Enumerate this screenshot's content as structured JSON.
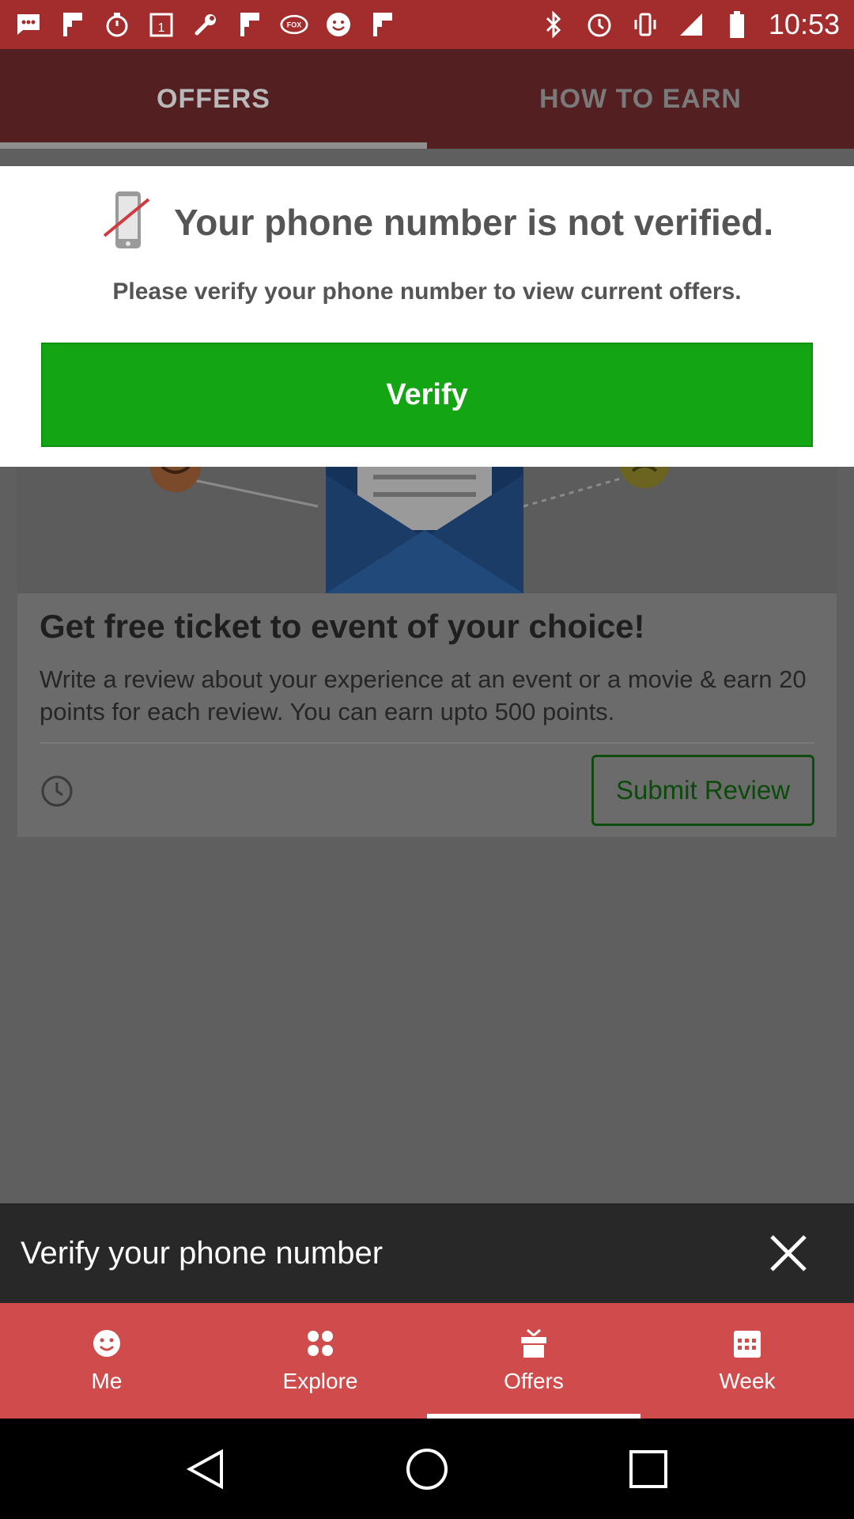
{
  "status_bar": {
    "time": "10:53",
    "left_icons": [
      "chat-icon",
      "fox-flag-icon",
      "stopwatch-icon",
      "calendar-1-icon",
      "wrench-icon",
      "fox-flag-icon",
      "fox-sports-icon",
      "smiley-icon",
      "fox-flag-icon"
    ],
    "right_icons": [
      "bluetooth-icon",
      "alarm-icon",
      "vibrate-icon",
      "signal-icon",
      "battery-icon"
    ]
  },
  "top_tabs": [
    {
      "label": "OFFERS",
      "active": true
    },
    {
      "label": "HOW TO EARN",
      "active": false
    }
  ],
  "modal": {
    "title": "Your phone number is not verified.",
    "subtitle": "Please verify your phone number to view current offers.",
    "verify_label": "Verify",
    "icon": "phone-crossed-icon"
  },
  "card": {
    "title": "Get free ticket to event of your choice!",
    "description": "Write a review about your experience at an event or a movie & earn 20 points for each review. You can earn upto 500 points.",
    "submit_label": "Submit Review"
  },
  "snackbar": {
    "text": "Verify your phone number"
  },
  "bottom_nav": [
    {
      "label": "Me",
      "icon": "smiley-icon"
    },
    {
      "label": "Explore",
      "icon": "dots-grid-icon"
    },
    {
      "label": "Offers",
      "icon": "gift-icon",
      "active": true
    },
    {
      "label": "Week",
      "icon": "calendar-icon"
    }
  ],
  "colors": {
    "status_bar": "#a32d2d",
    "tab_bar_dimmed": "#531f21",
    "verify_green": "#13a513",
    "bottom_nav": "#d04b4b",
    "snackbar": "#282828"
  }
}
